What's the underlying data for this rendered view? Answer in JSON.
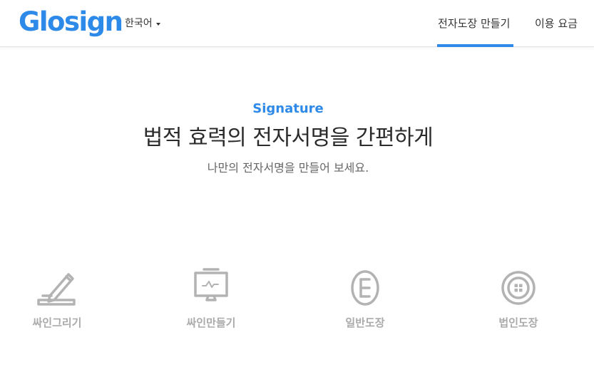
{
  "header": {
    "logo": "Glosign",
    "language": "한국어",
    "nav": [
      {
        "label": "전자도장 만들기",
        "active": true
      },
      {
        "label": "이용 요금",
        "active": false
      }
    ]
  },
  "hero": {
    "kicker": "Signature",
    "title": "법적 효력의 전자서명을 간편하게",
    "subtitle": "나만의 전자서명을 만들어 보세요."
  },
  "options": [
    {
      "label": "싸인그리기",
      "icon": "pen-draw-icon"
    },
    {
      "label": "싸인만들기",
      "icon": "monitor-signature-icon"
    },
    {
      "label": "일반도장",
      "icon": "oval-stamp-icon"
    },
    {
      "label": "법인도장",
      "icon": "round-corporate-stamp-icon"
    }
  ],
  "colors": {
    "brand": "#2d8ae8",
    "icon_gray": "#b3b3b3",
    "label_gray": "#aaaaaa",
    "title": "#2b2b2b"
  }
}
